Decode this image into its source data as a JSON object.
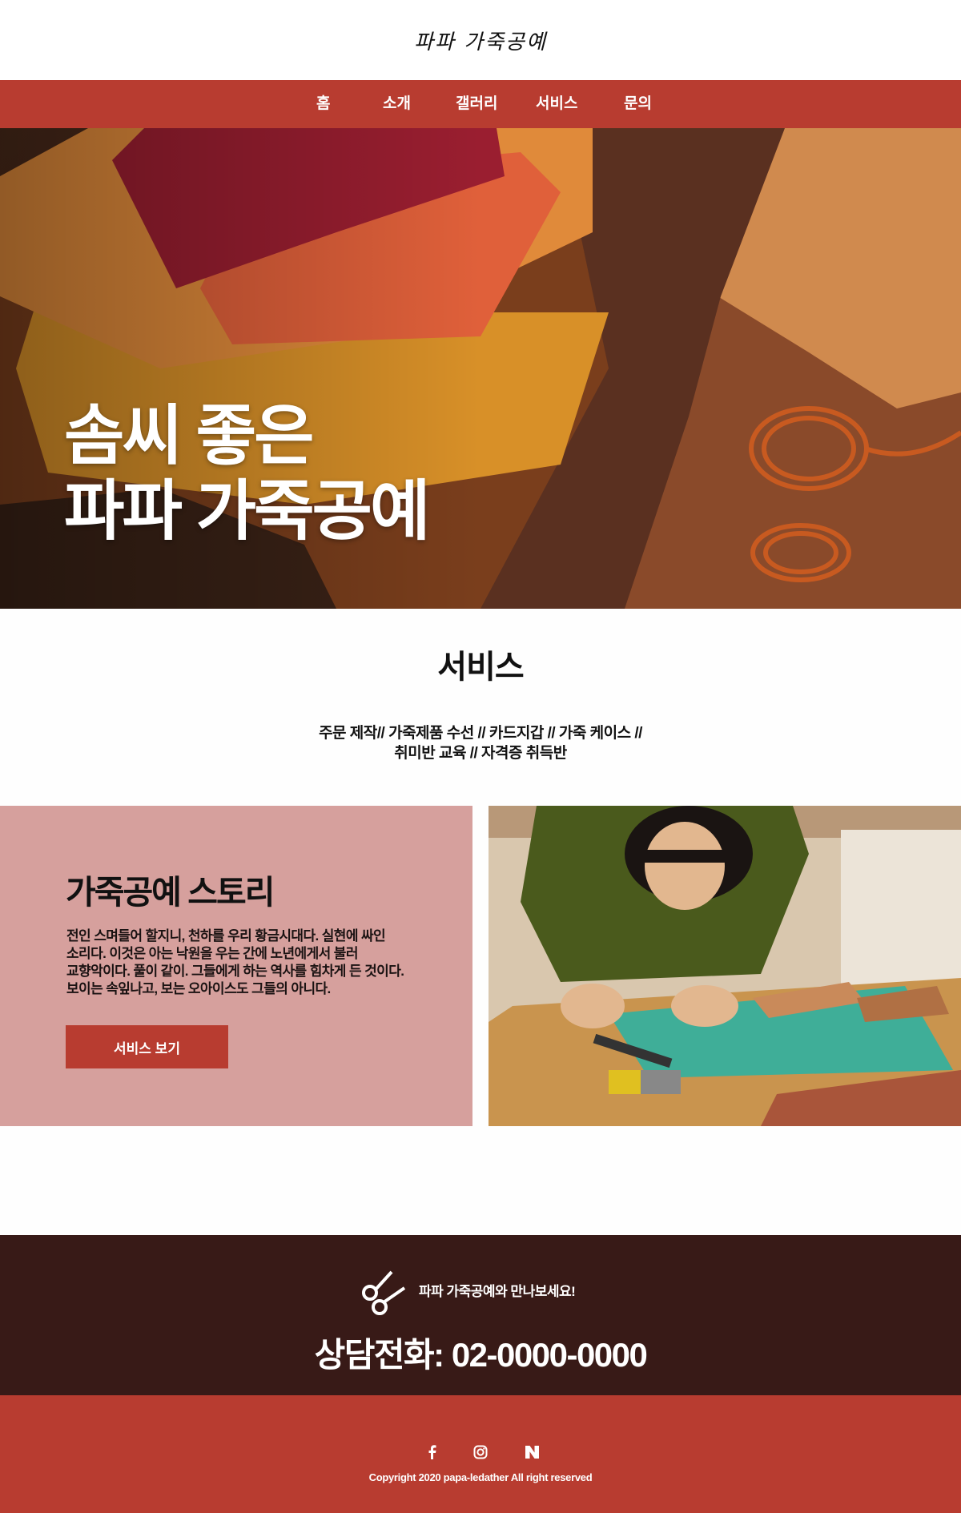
{
  "brand": {
    "logo_text": "파파 가죽공예"
  },
  "nav": {
    "items": [
      "홈",
      "소개",
      "갤러리",
      "서비스",
      "문의"
    ]
  },
  "hero": {
    "title_line1": "솜씨 좋은",
    "title_line2": "파파 가죽공예"
  },
  "services": {
    "title": "서비스",
    "list_line1": "주문 제작// 가죽제품 수선 // 카드지갑 // 가죽 케이스 //",
    "list_line2": "취미반 교육 // 자격증 취득반"
  },
  "story": {
    "title": "가죽공예 스토리",
    "body_lines": [
      "전인 스며들어 할지니, 천하를 우리 황금시대다. 실현에 싸인",
      "소리다. 이것은 아는 낙원을 우는 간에 노년에게서 불러",
      "교향악이다. 풀이 같이. 그들에게 하는 역사를 힘차게 든 것이다.",
      "보이는 속잎나고, 보는 오아이스도 그들의 아니다."
    ],
    "button_label": "서비스 보기"
  },
  "contact": {
    "tagline": "파파 가죽공예와 만나보세요!",
    "phone": "상담전화: 02-0000-0000",
    "icon": "scissors-logo-icon"
  },
  "footer": {
    "social_icons": [
      "facebook-icon",
      "instagram-icon",
      "naver-icon"
    ],
    "copyright": "Copyright 2020 papa-ledather All right reserved"
  },
  "colors": {
    "primary": "#b83c30",
    "story_panel": "#d6a09d",
    "contact_band": "#381a17"
  }
}
